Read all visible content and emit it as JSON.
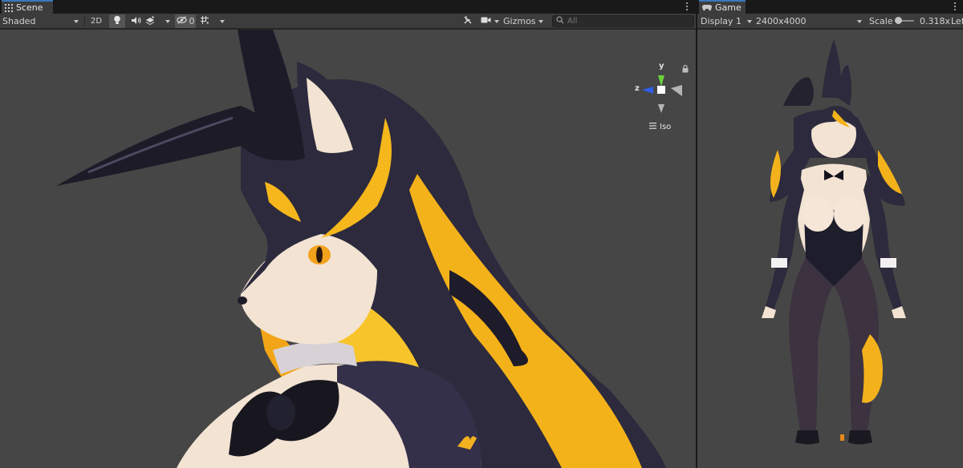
{
  "scene": {
    "tab_label": "Scene",
    "draw_mode": "Shaded",
    "mode_2d_label": "2D",
    "hidden_count": "0",
    "gizmos_label": "Gizmos",
    "search_placeholder": "All",
    "axis_labels": {
      "y": "y",
      "z": "z"
    },
    "projection_label": "Iso"
  },
  "game": {
    "tab_label": "Game",
    "display": "Display 1",
    "resolution": "2400x4000",
    "scale_label": "Scale",
    "scale_value": "0.318x",
    "overflow_label": "Lef"
  },
  "icons": [
    "scene-grid-icon",
    "light-icon",
    "audio-icon",
    "effects-icon",
    "visibility-icon",
    "grid-toggle-icon",
    "tools-icon",
    "camera-icon",
    "search-icon",
    "lock-icon",
    "gamepad-icon",
    "kebab-menu-icon"
  ],
  "colors": {
    "accent": "#3a79bb",
    "panel": "#282828",
    "toolbar": "#3c3c3c",
    "viewport": "#464646",
    "axis_x": "#e52e2e",
    "axis_y": "#6cd33b",
    "axis_z": "#2e5fe5"
  }
}
